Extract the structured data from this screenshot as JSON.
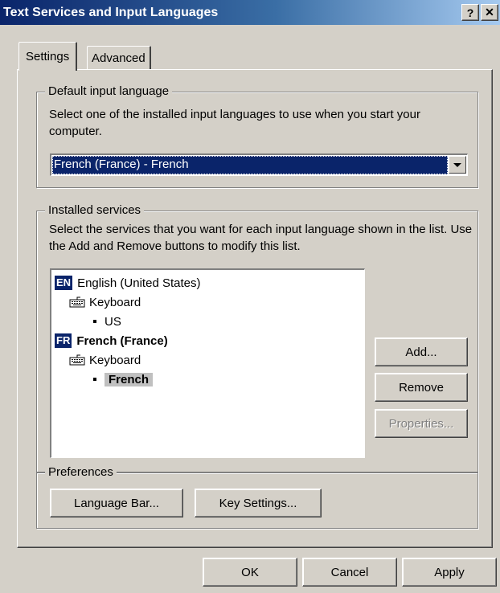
{
  "window": {
    "title": "Text Services and Input Languages"
  },
  "titlebar": {
    "help_label": "?",
    "close_label": "✕"
  },
  "tabs": [
    {
      "label": "Settings"
    },
    {
      "label": "Advanced"
    }
  ],
  "default_lang": {
    "legend": "Default input language",
    "description": "Select one of the installed input languages to use when you start your computer.",
    "selected": "French (France) - French"
  },
  "installed": {
    "legend": "Installed services",
    "description": "Select the services that you want for each input language shown in the list. Use the Add and Remove buttons to modify this list.",
    "tree": [
      {
        "badge": "EN",
        "language": "English (United States)",
        "category": "Keyboard",
        "layout": "US"
      },
      {
        "badge": "FR",
        "language": "French (France)",
        "category": "Keyboard",
        "layout": "French"
      }
    ],
    "add_label": "Add...",
    "remove_label": "Remove",
    "properties_label": "Properties..."
  },
  "preferences": {
    "legend": "Preferences",
    "language_bar_label": "Language Bar...",
    "key_settings_label": "Key Settings..."
  },
  "footer": {
    "ok_label": "OK",
    "cancel_label": "Cancel",
    "apply_label": "Apply"
  },
  "colors": {
    "face": "#d4d0c8",
    "selection": "#0a246a",
    "title_start": "#0a246a",
    "title_end": "#a6caf0"
  }
}
